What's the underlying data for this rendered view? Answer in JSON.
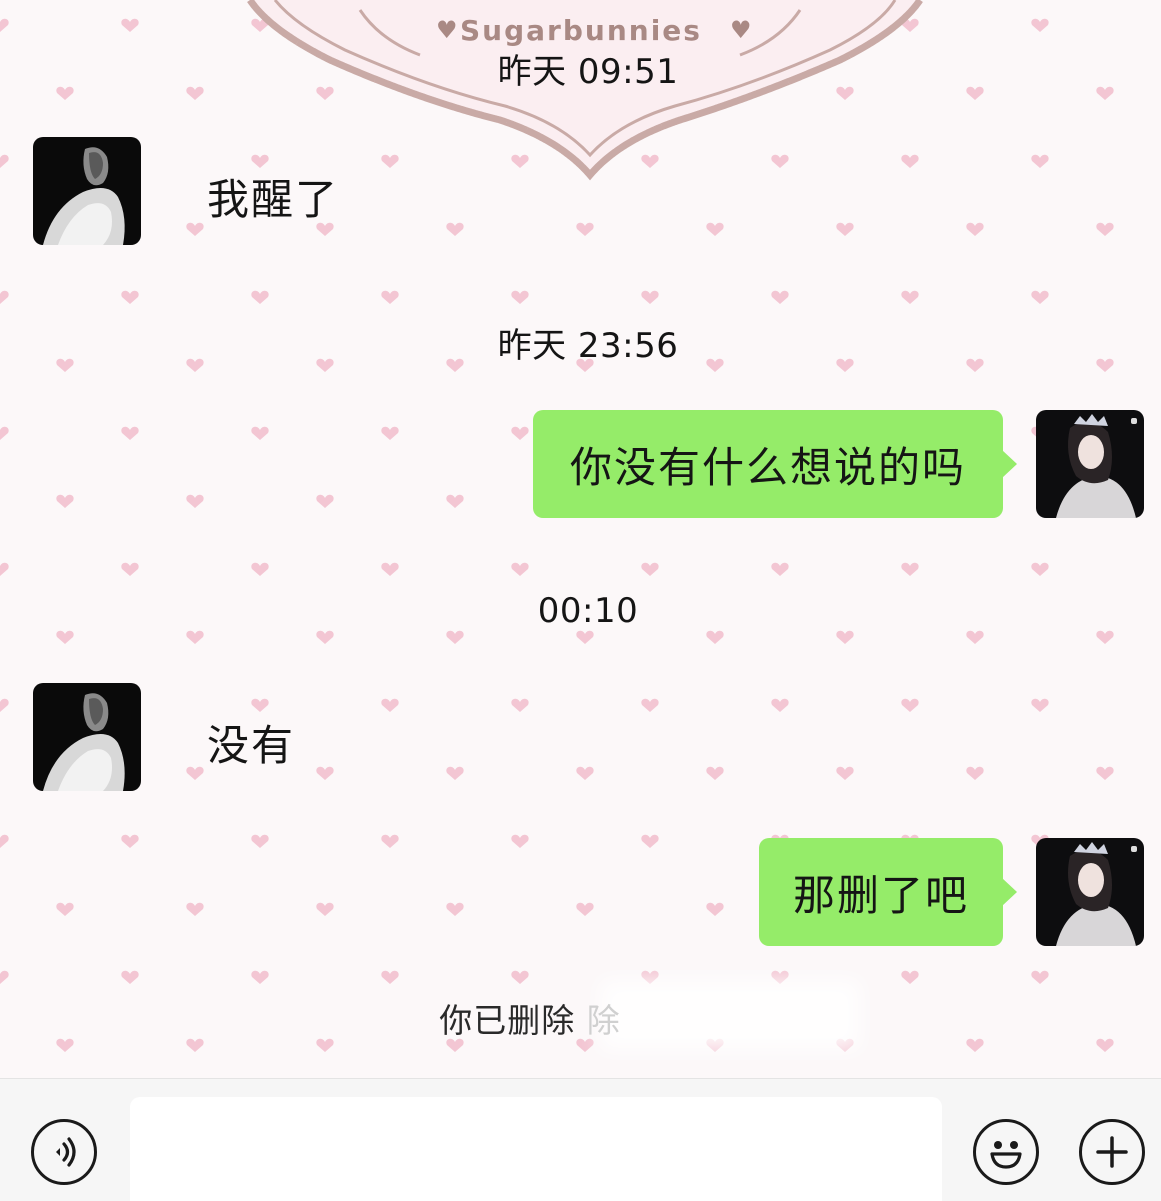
{
  "chat": {
    "banner_text": "Sugarbunnies",
    "timestamps": [
      "昨天 09:51",
      "昨天 23:56",
      "00:10"
    ],
    "messages": [
      {
        "from": "contact",
        "text": "我醒了"
      },
      {
        "from": "me",
        "text": "你没有什么想说的吗"
      },
      {
        "from": "contact",
        "text": "没有"
      },
      {
        "from": "me",
        "text": "那删了吧"
      }
    ],
    "system_note": "你已删除",
    "system_note_faded": "除"
  },
  "colors": {
    "bubble_green": "#95ec69",
    "heart_pink": "#f3c6d3",
    "banner_stroke": "#c9aaa6"
  },
  "input_bar": {
    "voice_icon": "voice-icon",
    "emoji_icon": "emoji-icon",
    "plus_icon": "plus-icon"
  }
}
